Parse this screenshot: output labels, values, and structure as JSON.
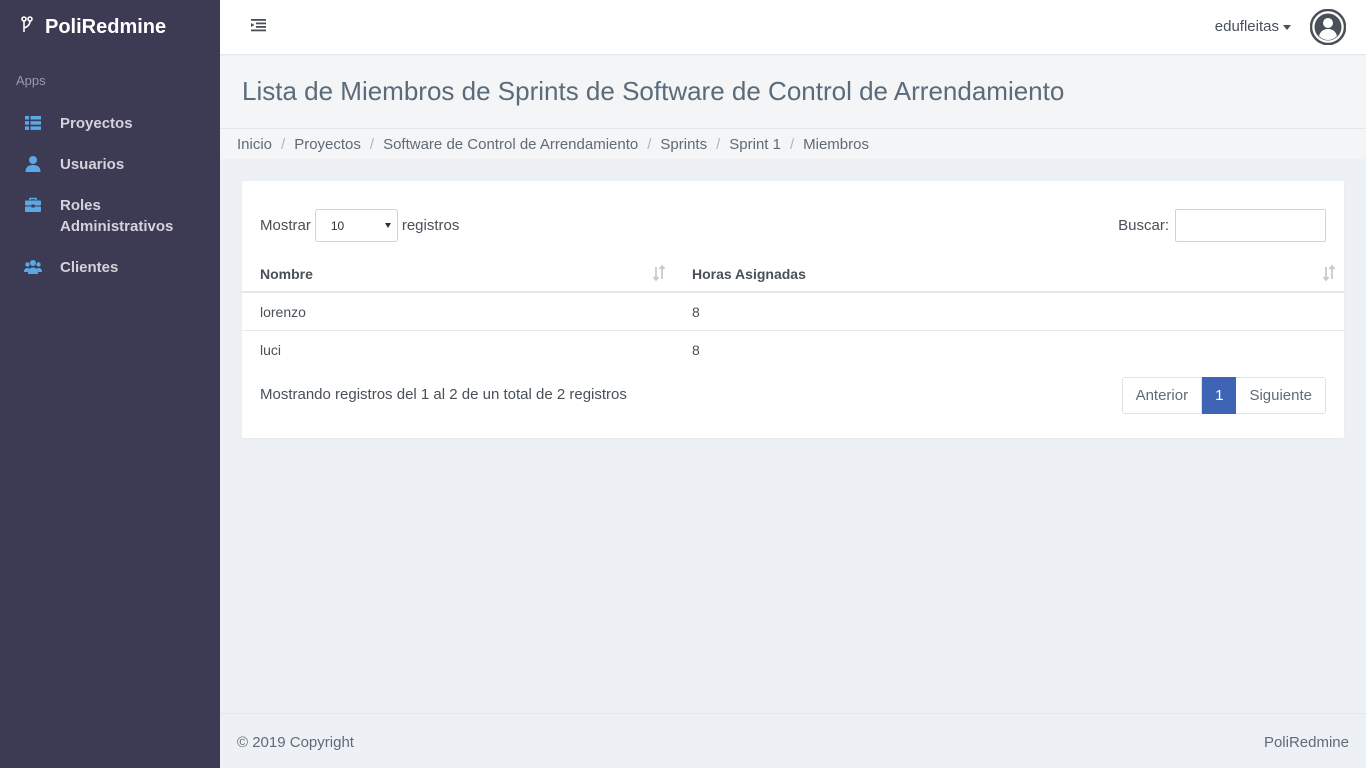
{
  "app": {
    "brand": "PoliRedmine"
  },
  "sidebar": {
    "section_label": "Apps",
    "items": [
      {
        "label": "Proyectos",
        "icon": "list-icon"
      },
      {
        "label": "Usuarios",
        "icon": "user-icon"
      },
      {
        "label": "Roles Administrativos",
        "icon": "briefcase-icon"
      },
      {
        "label": "Clientes",
        "icon": "users-icon"
      }
    ]
  },
  "topbar": {
    "username": "edufleitas"
  },
  "page": {
    "title": "Lista de Miembros de Sprints de Software de Control de Arrendamiento"
  },
  "breadcrumb": [
    "Inicio",
    "Proyectos",
    "Software de Control de Arrendamiento",
    "Sprints",
    "Sprint 1",
    "Miembros"
  ],
  "table_controls": {
    "show_label": "Mostrar",
    "page_size": "10",
    "records_label": "registros",
    "search_label": "Buscar:",
    "search_value": ""
  },
  "table": {
    "columns": [
      "Nombre",
      "Horas Asignadas"
    ],
    "rows": [
      [
        "lorenzo",
        "8"
      ],
      [
        "luci",
        "8"
      ]
    ]
  },
  "pagination": {
    "info": "Mostrando registros del 1 al 2 de un total de 2 registros",
    "previous": "Anterior",
    "current_page": "1",
    "next": "Siguiente"
  },
  "footer": {
    "copyright": "© 2019 Copyright",
    "brand": "PoliRedmine"
  },
  "colors": {
    "sidebar_bg": "#3d3a54",
    "accent": "#3f64b6",
    "icon_blue": "#5aa9e6"
  }
}
